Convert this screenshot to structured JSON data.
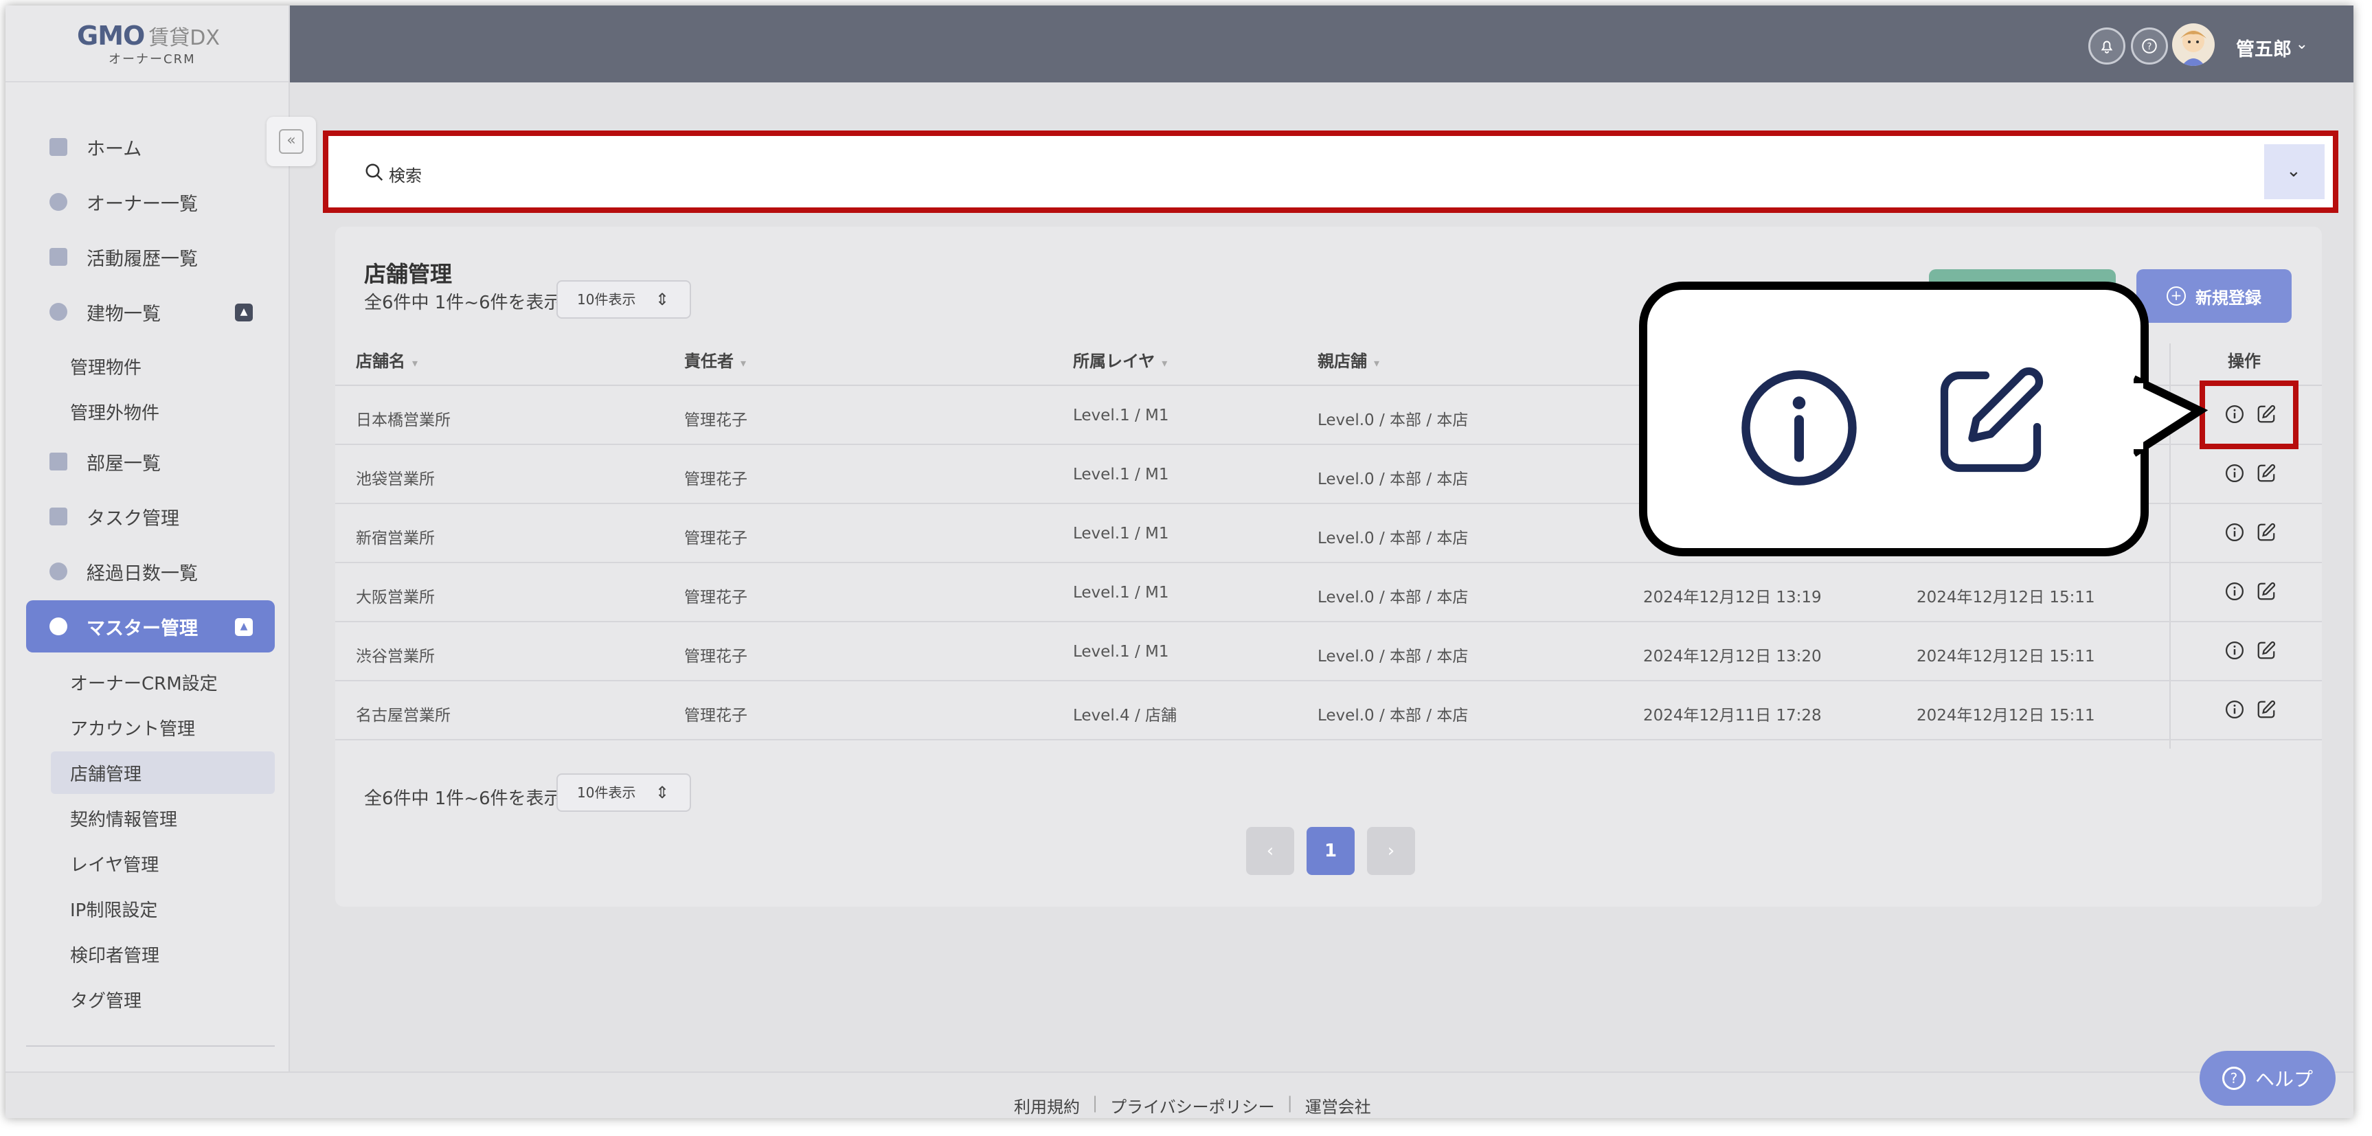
{
  "brand": {
    "logo": "GMO",
    "product": "賃貸DX",
    "subtitle": "オーナーCRM"
  },
  "header": {
    "user_name": "管五郎",
    "notification_icon": "bell-icon",
    "help_icon": "question-circle-icon"
  },
  "sidebar": {
    "items": [
      {
        "label": "ホーム",
        "icon": "grid-icon"
      },
      {
        "label": "オーナー一覧",
        "icon": "user-icon"
      },
      {
        "label": "活動履歴一覧",
        "icon": "document-icon"
      },
      {
        "label": "建物一覧",
        "icon": "building-icon"
      },
      {
        "label": "部屋一覧",
        "icon": "room-icon"
      },
      {
        "label": "タスク管理",
        "icon": "task-icon"
      },
      {
        "label": "経過日数一覧",
        "icon": "check-icon"
      },
      {
        "label": "マスター管理",
        "icon": "gear-icon"
      }
    ],
    "building_sub": [
      "管理物件",
      "管理外物件"
    ],
    "master_sub": [
      "オーナーCRM設定",
      "アカウント管理",
      "店舗管理",
      "契約情報管理",
      "レイヤ管理",
      "IP制限設定",
      "検印者管理",
      "タグ管理"
    ]
  },
  "search": {
    "placeholder": "検索"
  },
  "panel": {
    "title": "店舗管理",
    "count_text": "全6件中 1件~6件を表示",
    "per_page": "10件表示",
    "new_button": "新規登録"
  },
  "table": {
    "columns": [
      "店舗名",
      "責任者",
      "所属レイヤ",
      "親店舗",
      "操作"
    ],
    "rows": [
      {
        "name": "日本橋営業所",
        "manager": "管理花子",
        "layer": "Level.1 / M1",
        "parent": "Level.0 / 本部 / 本店",
        "created": "",
        "updated": ""
      },
      {
        "name": "池袋営業所",
        "manager": "管理花子",
        "layer": "Level.1 / M1",
        "parent": "Level.0 / 本部 / 本店",
        "created": "",
        "updated": ""
      },
      {
        "name": "新宿営業所",
        "manager": "管理花子",
        "layer": "Level.1 / M1",
        "parent": "Level.0 / 本部 / 本店",
        "created": "",
        "updated": ""
      },
      {
        "name": "大阪営業所",
        "manager": "管理花子",
        "layer": "Level.1 / M1",
        "parent": "Level.0 / 本部 / 本店",
        "created": "2024年12月12日 13:19",
        "updated": "2024年12月12日 15:11"
      },
      {
        "name": "渋谷営業所",
        "manager": "管理花子",
        "layer": "Level.1 / M1",
        "parent": "Level.0 / 本部 / 本店",
        "created": "2024年12月12日 13:20",
        "updated": "2024年12月12日 15:11"
      },
      {
        "name": "名古屋営業所",
        "manager": "管理花子",
        "layer": "Level.4 / 店舗",
        "parent": "Level.0 / 本部 / 本店",
        "created": "2024年12月11日 17:28",
        "updated": "2024年12月12日 15:11"
      }
    ]
  },
  "pagination": {
    "current": "1",
    "prev": "‹",
    "next": "›"
  },
  "footer": {
    "links": [
      "利用規約",
      "プライバシーポリシー",
      "運営会社"
    ]
  },
  "help": {
    "label": "ヘルプ"
  },
  "colors": {
    "accent": "#6f82d2",
    "highlight": "#b70d0d",
    "header": "#656a78"
  }
}
